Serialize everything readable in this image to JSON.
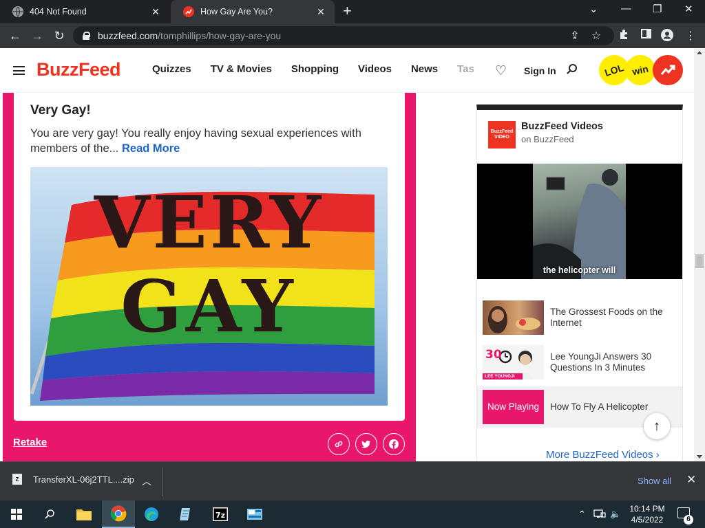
{
  "browser": {
    "tabs": [
      {
        "title": "404 Not Found",
        "active": false
      },
      {
        "title": "How Gay Are You?",
        "active": true
      }
    ],
    "url_host": "buzzfeed.com",
    "url_path": "/tomphillips/how-gay-are-you"
  },
  "header": {
    "logo": "BuzzFeed",
    "nav": [
      "Quizzes",
      "TV & Movies",
      "Shopping",
      "Videos",
      "News",
      "Tas"
    ],
    "sign_in": "Sign In",
    "badges": {
      "lol": "LOL",
      "win": "win"
    }
  },
  "result": {
    "title": "Very Gay!",
    "description": "You are very gay! You really enjoy having sexual experiences with members of the...",
    "read_more": "Read More",
    "image_text_line1": "VERY",
    "image_text_line2": "GAY",
    "retake": "Retake",
    "colors": {
      "card": "#e8176c",
      "link": "#1d63c8"
    }
  },
  "sidebar": {
    "channel_name": "BuzzFeed Videos",
    "channel_sub": "on BuzzFeed",
    "logo_text": "BuzzFeed VIDEO",
    "player_caption": "the helicopter will",
    "videos": [
      {
        "title": "The Grossest Foods on the Internet"
      },
      {
        "title": "Lee YoungJi Answers 30 Questions In 3 Minutes",
        "thumb_tag": "LEE YOUNGJI",
        "thumb_number": "30"
      },
      {
        "title": "How To Fly A Helicopter",
        "now_playing": "Now Playing"
      }
    ],
    "more_link": "More BuzzFeed Videos ›"
  },
  "downloads": {
    "file": "TransferXL-06j2TTL....zip",
    "show_all": "Show all"
  },
  "taskbar": {
    "time": "10:14 PM",
    "date": "4/5/2022",
    "notifications": "6"
  }
}
